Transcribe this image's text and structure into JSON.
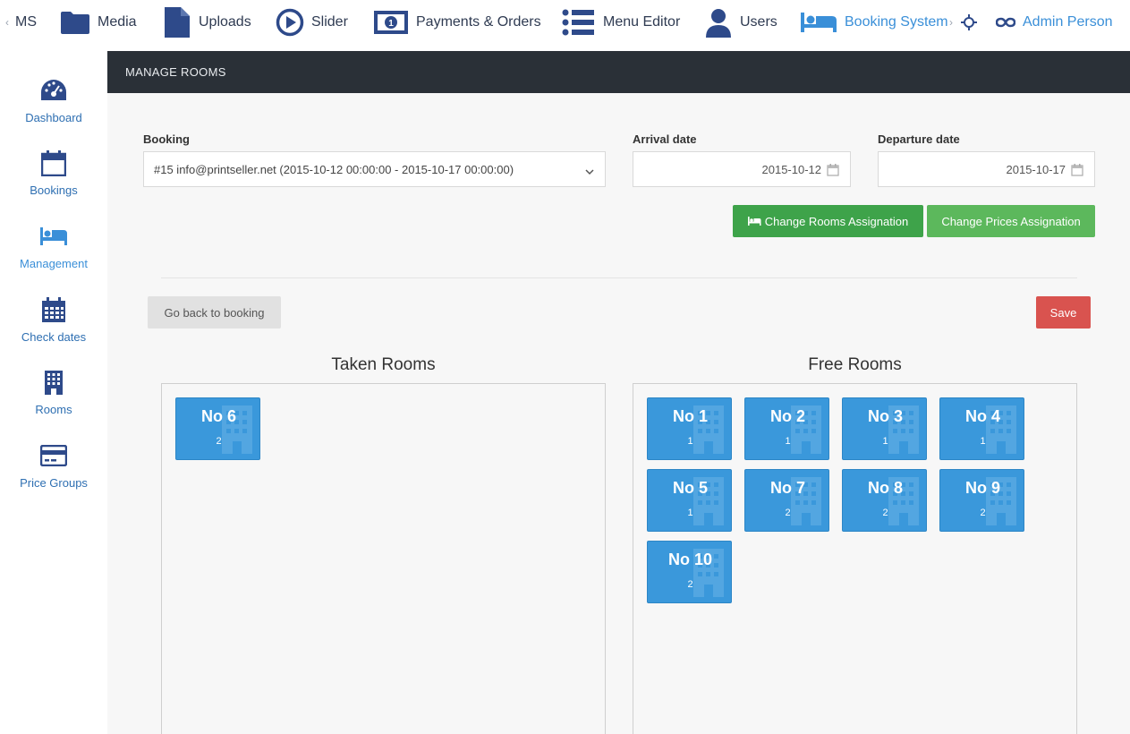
{
  "topnav": {
    "items": [
      {
        "label": "MS",
        "icon": "chevron-left-icon"
      },
      {
        "label": "Media",
        "icon": "folder-icon"
      },
      {
        "label": "Uploads",
        "icon": "file-icon"
      },
      {
        "label": "Slider",
        "icon": "play-circle-icon"
      },
      {
        "label": "Payments & Orders",
        "icon": "money-icon"
      },
      {
        "label": "Menu Editor",
        "icon": "list-icon"
      },
      {
        "label": "Users",
        "icon": "user-icon"
      },
      {
        "label": "Booking System",
        "icon": "bed-icon"
      },
      {
        "label": "Admin Person",
        "icon": "infinity-icon"
      }
    ],
    "nav_arrow_left": "‹",
    "nav_arrow_right": "›"
  },
  "sidebar": {
    "items": [
      {
        "label": "Dashboard",
        "icon": "dashboard-icon"
      },
      {
        "label": "Bookings",
        "icon": "calendar-icon"
      },
      {
        "label": "Management",
        "icon": "bed-icon"
      },
      {
        "label": "Check dates",
        "icon": "calendar-grid-icon"
      },
      {
        "label": "Rooms",
        "icon": "building-icon"
      },
      {
        "label": "Price Groups",
        "icon": "credit-card-icon"
      }
    ],
    "active": "Management"
  },
  "header": {
    "title": "MANAGE ROOMS"
  },
  "form": {
    "booking_label": "Booking",
    "booking_value": "#15 info@printseller.net (2015-10-12 00:00:00 - 2015-10-17 00:00:00)",
    "arrival_label": "Arrival date",
    "arrival_value": "2015-10-12",
    "departure_label": "Departure date",
    "departure_value": "2015-10-17"
  },
  "buttons": {
    "change_rooms": "Change Rooms Assignation",
    "change_prices": "Change Prices Assignation",
    "go_back": "Go back to booking",
    "save": "Save"
  },
  "taken": {
    "title": "Taken Rooms",
    "rooms": [
      {
        "name": "No 6",
        "beds": "2"
      }
    ]
  },
  "free": {
    "title": "Free Rooms",
    "rooms": [
      {
        "name": "No 1",
        "beds": "1"
      },
      {
        "name": "No 2",
        "beds": "1"
      },
      {
        "name": "No 3",
        "beds": "1"
      },
      {
        "name": "No 4",
        "beds": "1"
      },
      {
        "name": "No 5",
        "beds": "1"
      },
      {
        "name": "No 7",
        "beds": "2"
      },
      {
        "name": "No 8",
        "beds": "2"
      },
      {
        "name": "No 9",
        "beds": "2"
      },
      {
        "name": "No 10",
        "beds": "2"
      }
    ]
  },
  "colors": {
    "accent": "#3a8fd8",
    "header_bg": "#2a3037",
    "room_bg": "#3a98db",
    "btn_green_dark": "#3ea34a",
    "btn_green": "#5cb85c",
    "btn_red": "#d9534f"
  }
}
